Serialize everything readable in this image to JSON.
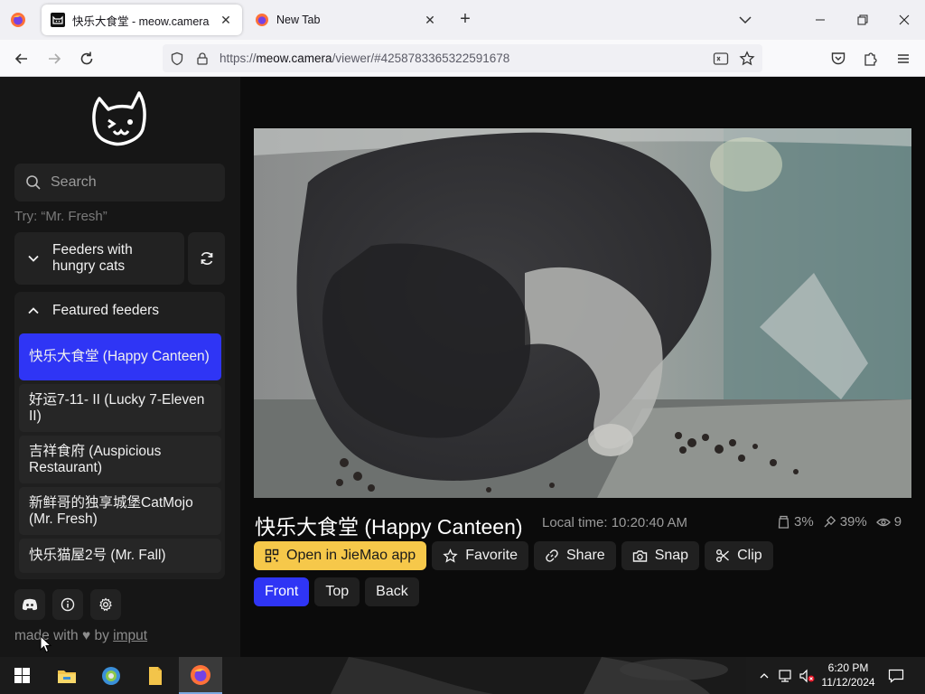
{
  "browser": {
    "tabs": [
      {
        "title": "快乐大食堂 - meow.camera",
        "active": true
      },
      {
        "title": "New Tab",
        "active": false
      }
    ],
    "url": {
      "scheme": "https://",
      "host": "meow.camera",
      "path": "/viewer/#4258783365322591678"
    }
  },
  "sidebar": {
    "search_placeholder": "Search",
    "hint": "Try: “Mr. Fresh”",
    "group_feeders_label": "Feeders with hungry cats",
    "featured_label": "Featured feeders",
    "featured_items": [
      {
        "label": "快乐大食堂 (Happy Canteen)",
        "selected": true
      },
      {
        "label": "好运7-11- II  (Lucky 7-Eleven II)",
        "selected": false
      },
      {
        "label": "吉祥食府 (Auspicious Restaurant)",
        "selected": false
      },
      {
        "label": "新鲜哥的独享城堡CatMojo (Mr. Fresh)",
        "selected": false
      },
      {
        "label": "快乐猫屋2号 (Mr. Fall)",
        "selected": false
      }
    ],
    "footer": {
      "made_with": "made with",
      "by": "by",
      "author": "imput"
    }
  },
  "viewer": {
    "camera_name": "快乐大食堂 (Happy Canteen)",
    "local_time_label": "Local time:",
    "local_time": "10:20:40 AM",
    "stats": {
      "food": "3%",
      "signal": "39%",
      "viewers": "9"
    },
    "actions": {
      "open_app": "Open in JieMao app",
      "favorite": "Favorite",
      "share": "Share",
      "snap": "Snap",
      "clip": "Clip"
    },
    "views": [
      {
        "label": "Front",
        "active": true
      },
      {
        "label": "Top",
        "active": false
      },
      {
        "label": "Back",
        "active": false
      }
    ]
  },
  "taskbar": {
    "time": "6:20 PM",
    "date": "11/12/2024"
  },
  "colors": {
    "accent_blue": "#2f35f5",
    "accent_yellow": "#f6c84a",
    "sidebar_bg": "#161616"
  }
}
